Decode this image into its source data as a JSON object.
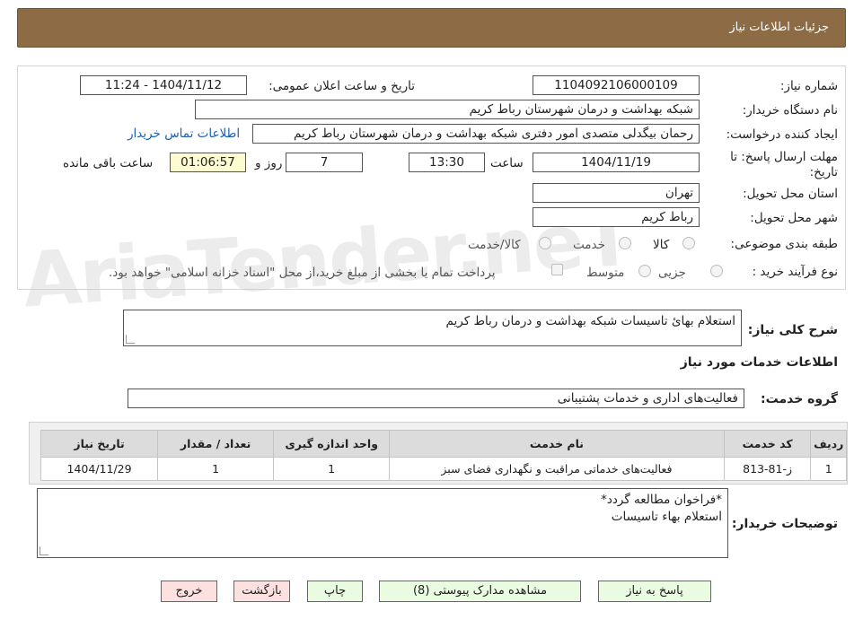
{
  "header": {
    "title": "جزئیات اطلاعات نیاز"
  },
  "form": {
    "need_number_label": "شماره نیاز:",
    "need_number": "1104092106000109",
    "announce_label": "تاریخ و ساعت اعلان عمومی:",
    "announce_value": "1404/11/12 - 11:24",
    "buyer_org_label": "نام دستگاه خریدار:",
    "buyer_org": "شبکه بهداشت و درمان شهرستان رباط کریم",
    "creator_label": "ایجاد کننده درخواست:",
    "creator": "رحمان بیگدلی متصدی امور دفتری شبکه بهداشت و درمان شهرستان رباط کریم",
    "contact_link": "اطلاعات تماس خریدار",
    "deadline_label_1": "مهلت ارسال پاسخ: تا",
    "deadline_label_2": "تاریخ:",
    "deadline_date": "1404/11/19",
    "time_label": "ساعت",
    "deadline_time": "13:30",
    "days_value": "7",
    "days_label": "روز و",
    "remaining_time": "01:06:57",
    "remaining_label": "ساعت باقی مانده",
    "province_label": "استان محل تحویل:",
    "province": "تهران",
    "city_label": "شهر محل تحویل:",
    "city": "رباط کریم",
    "category_label": "طبقه بندی موضوعی:",
    "category_options": [
      "کالا",
      "خدمت",
      "کالا/خدمت"
    ],
    "purchase_type_label": "نوع فرآیند خرید :",
    "purchase_options": [
      "جزیی",
      "متوسط"
    ],
    "treasury_note": "پرداخت تمام یا بخشی از مبلغ خرید،از محل \"اسناد خزانه اسلامی\" خواهد بود."
  },
  "description": {
    "label": "شرح کلی نیاز:",
    "value": "استعلام بهائ تاسیسات شبکه بهداشت و درمان رباط کریم"
  },
  "services": {
    "section_title": "اطلاعات خدمات مورد نیاز",
    "group_label": "گروه خدمت:",
    "group_value": "فعالیت‌های اداری و خدمات پشتیبانی",
    "columns": [
      "ردیف",
      "کد خدمت",
      "نام خدمت",
      "واحد اندازه گیری",
      "تعداد / مقدار",
      "تاریخ نیاز"
    ],
    "rows": [
      {
        "row": "1",
        "code": "ز-81-813",
        "name": "فعالیت‌های خدماتی مراقبت و نگهداری فضای سبز",
        "unit": "1",
        "qty": "1",
        "date": "1404/11/29"
      }
    ]
  },
  "buyer_notes": {
    "label": "توضیحات خریدار:",
    "line1": "*فراخوان مطالعه گردد*",
    "line2": "استعلام بهاء تاسیسات"
  },
  "buttons": {
    "reply": "پاسخ به نیاز",
    "attachments": "مشاهده مدارک پیوستی (8)",
    "print": "چاپ",
    "back": "بازگشت",
    "exit": "خروج"
  },
  "watermark": "AriaTender.neT"
}
